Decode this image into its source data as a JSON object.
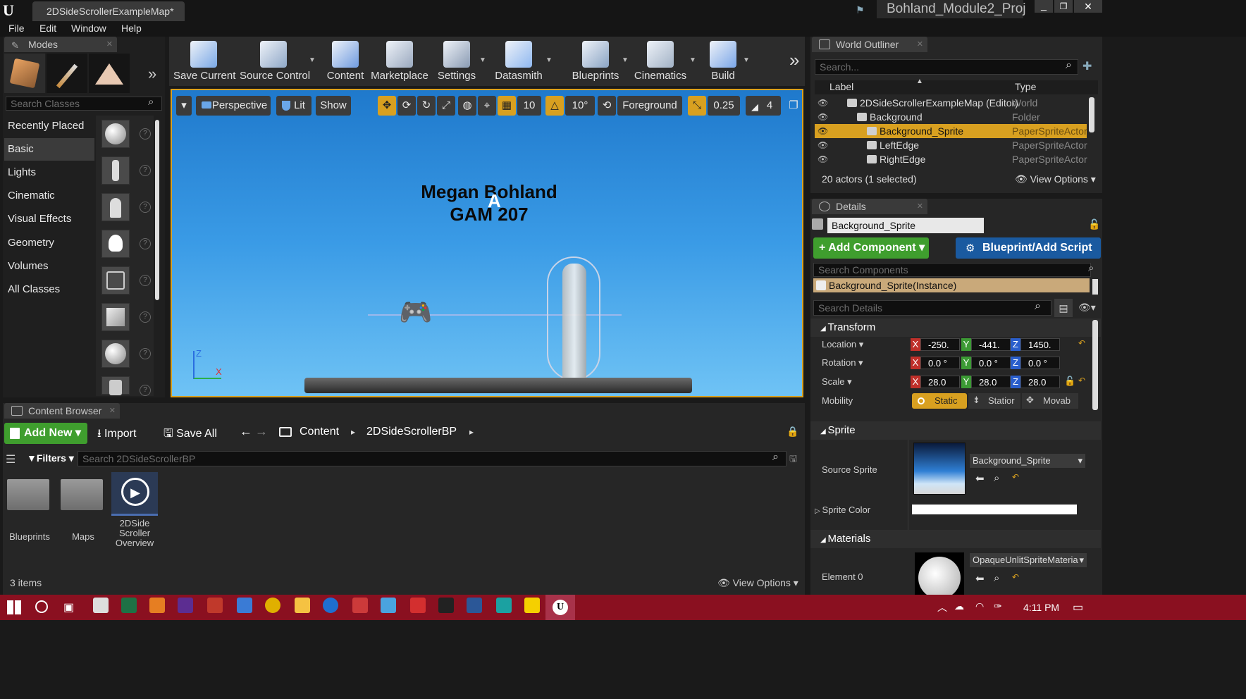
{
  "title_bar": {
    "tab_title": "2DSideScrollerExampleMap*",
    "project_name": "Bohland_Module2_Proj"
  },
  "menu": [
    "File",
    "Edit",
    "Window",
    "Help"
  ],
  "modes": {
    "tab_label": "Modes",
    "search_placeholder": "Search Classes",
    "categories": [
      "Recently Placed",
      "Basic",
      "Lights",
      "Cinematic",
      "Visual Effects",
      "Geometry",
      "Volumes",
      "All Classes"
    ]
  },
  "toolbar": {
    "buttons": [
      {
        "label": "Save Current",
        "icon": "save-icon",
        "color": "#7aa8e6"
      },
      {
        "label": "Source Control",
        "icon": "source-control-icon",
        "color": "#8fa8c8"
      },
      {
        "label": "Content",
        "icon": "content-icon",
        "color": "#6f9be0"
      },
      {
        "label": "Marketplace",
        "icon": "marketplace-icon",
        "color": "#9aa9bf"
      },
      {
        "label": "Settings",
        "icon": "settings-icon",
        "color": "#8a9bb3"
      },
      {
        "label": "Datasmith",
        "icon": "datasmith-icon",
        "color": "#8fb8f0"
      },
      {
        "label": "Blueprints",
        "icon": "blueprints-icon",
        "color": "#8aa4c4"
      },
      {
        "label": "Cinematics",
        "icon": "cinematics-icon",
        "color": "#a2b2c6"
      },
      {
        "label": "Build",
        "icon": "build-icon",
        "color": "#7aa6e8"
      }
    ]
  },
  "viewport": {
    "perspective": "Perspective",
    "lit": "Lit",
    "show": "Show",
    "grid_snap": "10",
    "rot_snap": "10°",
    "layer": "Foreground",
    "scale_snap": "0.25",
    "cam_speed": "4",
    "scene_text_line1": "Megan Bohland",
    "scene_text_line2": "GAM 207",
    "axis_z": "Z",
    "axis_x": "X"
  },
  "content_browser": {
    "tab_label": "Content Browser",
    "add_new": "Add New",
    "import": "Import",
    "save_all": "Save All",
    "path": [
      "Content",
      "2DSideScrollerBP"
    ],
    "filters": "Filters",
    "search_placeholder": "Search 2DSideScrollerBP",
    "items": [
      {
        "name": "Blueprints",
        "type": "folder"
      },
      {
        "name": "Maps",
        "type": "folder"
      },
      {
        "name_lines": [
          "2DSide",
          "Scroller",
          "Overview"
        ],
        "type": "asset"
      }
    ],
    "count": "3 items",
    "view_options": "View Options"
  },
  "outliner": {
    "tab_label": "World Outliner",
    "search_placeholder": "Search...",
    "col_label": "Label",
    "col_type": "Type",
    "rows": [
      {
        "label": "2DSideScrollerExampleMap (Editor)",
        "type": "World",
        "indent": 0
      },
      {
        "label": "Background",
        "type": "Folder",
        "indent": 1
      },
      {
        "label": "Background_Sprite",
        "type": "PaperSpriteActor",
        "indent": 2,
        "selected": true
      },
      {
        "label": "LeftEdge",
        "type": "PaperSpriteActor",
        "indent": 2
      },
      {
        "label": "RightEdge",
        "type": "PaperSpriteActor",
        "indent": 2
      }
    ],
    "summary": "20 actors (1 selected)",
    "view_options": "View Options"
  },
  "details": {
    "tab_label": "Details",
    "name_value": "Background_Sprite",
    "add_component": "+ Add Component",
    "blueprint": "Blueprint/Add Script",
    "search_components": "Search Components",
    "instance": "Background_Sprite(Instance)",
    "search_details": "Search Details",
    "transform": {
      "title": "Transform",
      "location": {
        "label": "Location",
        "x": "-250.",
        "y": "-441.",
        "z": "1450."
      },
      "rotation": {
        "label": "Rotation",
        "x": "0.0 °",
        "y": "0.0 °",
        "z": "0.0 °"
      },
      "scale": {
        "label": "Scale",
        "x": "28.0",
        "y": "28.0",
        "z": "28.0"
      },
      "mobility": {
        "label": "Mobility",
        "options": [
          "Static",
          "Statior",
          "Movab"
        ]
      }
    },
    "sprite": {
      "title": "Sprite",
      "source_label": "Source Sprite",
      "source_value": "Background_Sprite",
      "color_label": "Sprite Color"
    },
    "materials": {
      "title": "Materials",
      "element_label": "Element 0",
      "element_value": "OpaqueUnlitSpriteMateria"
    }
  },
  "taskbar": {
    "time": "4:11 PM"
  }
}
